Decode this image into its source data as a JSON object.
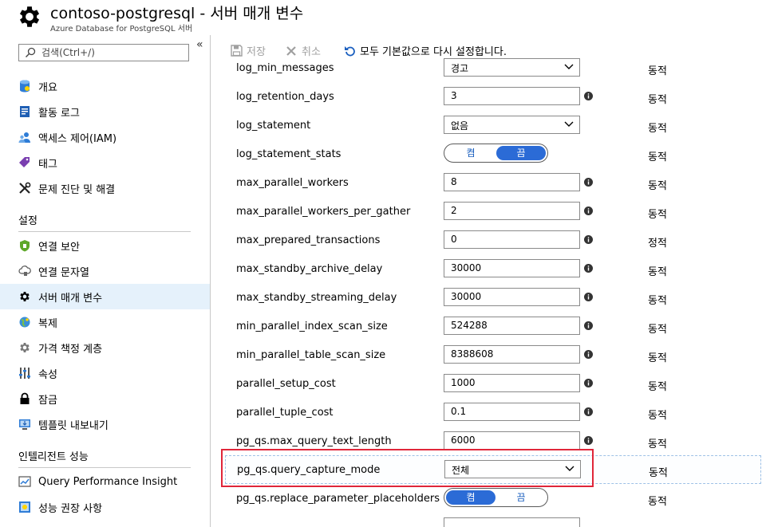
{
  "header": {
    "title": "contoso-postgresql - 서버 매개 변수",
    "subtitle": "Azure Database for PostgreSQL 서버",
    "icon": "gear-icon"
  },
  "sidebar": {
    "collapse_label": "«",
    "search_placeholder": "검색(Ctrl+/)",
    "items": [
      {
        "label": "개요",
        "icon": "overview-icon"
      },
      {
        "label": "활동 로그",
        "icon": "activity-log-icon"
      },
      {
        "label": "액세스 제어(IAM)",
        "icon": "iam-icon"
      },
      {
        "label": "태그",
        "icon": "tag-icon"
      },
      {
        "label": "문제 진단 및 해결",
        "icon": "diagnose-icon"
      }
    ],
    "settings_label": "설정",
    "settings_items": [
      {
        "label": "연결 보안",
        "icon": "shield-icon"
      },
      {
        "label": "연결 문자열",
        "icon": "connection-string-icon"
      },
      {
        "label": "서버 매개 변수",
        "icon": "gear-icon",
        "selected": true
      },
      {
        "label": "복제",
        "icon": "globe-icon"
      },
      {
        "label": "가격 책정 계층",
        "icon": "pricing-gear-icon"
      },
      {
        "label": "속성",
        "icon": "properties-icon"
      },
      {
        "label": "잠금",
        "icon": "lock-icon"
      },
      {
        "label": "템플릿 내보내기",
        "icon": "export-template-icon"
      }
    ],
    "intelligent_label": "인텔리전트 성능",
    "intelligent_items": [
      {
        "label": "Query Performance Insight",
        "icon": "query-insight-icon"
      },
      {
        "label": "성능 권장 사항",
        "icon": "recommendation-icon"
      }
    ]
  },
  "toolbar": {
    "save_label": "저장",
    "discard_label": "취소",
    "reset_label": "모두 기본값으로 다시 설정합니다."
  },
  "parameters": [
    {
      "name": "log_min_messages",
      "kind": "select",
      "value": "경고",
      "type": "동적"
    },
    {
      "name": "log_retention_days",
      "kind": "input",
      "value": "3",
      "type": "동적"
    },
    {
      "name": "log_statement",
      "kind": "select",
      "value": "없음",
      "type": "동적"
    },
    {
      "name": "log_statement_stats",
      "kind": "toggle",
      "on_label": "켬",
      "off_label": "끔",
      "value": "끔",
      "type": "동적"
    },
    {
      "name": "max_parallel_workers",
      "kind": "input",
      "value": "8",
      "type": "동적"
    },
    {
      "name": "max_parallel_workers_per_gather",
      "kind": "input",
      "value": "2",
      "type": "동적"
    },
    {
      "name": "max_prepared_transactions",
      "kind": "input",
      "value": "0",
      "type": "정적"
    },
    {
      "name": "max_standby_archive_delay",
      "kind": "input",
      "value": "30000",
      "type": "동적"
    },
    {
      "name": "max_standby_streaming_delay",
      "kind": "input",
      "value": "30000",
      "type": "동적"
    },
    {
      "name": "min_parallel_index_scan_size",
      "kind": "input",
      "value": "524288",
      "type": "동적"
    },
    {
      "name": "min_parallel_table_scan_size",
      "kind": "input",
      "value": "8388608",
      "type": "동적"
    },
    {
      "name": "parallel_setup_cost",
      "kind": "input",
      "value": "1000",
      "type": "동적"
    },
    {
      "name": "parallel_tuple_cost",
      "kind": "input",
      "value": "0.1",
      "type": "동적"
    },
    {
      "name": "pg_qs.max_query_text_length",
      "kind": "input",
      "value": "6000",
      "type": "동적"
    },
    {
      "name": "pg_qs.query_capture_mode",
      "kind": "select",
      "value": "전체",
      "type": "동적",
      "highlighted": true
    },
    {
      "name": "pg_qs.replace_parameter_placeholders",
      "kind": "toggle",
      "on_label": "켬",
      "off_label": "끔",
      "value": "켬",
      "type": "동적"
    }
  ],
  "colors": {
    "accent": "#2b6bd6",
    "highlight_border": "#e0263a",
    "selected_nav": "#e5f1fb"
  }
}
